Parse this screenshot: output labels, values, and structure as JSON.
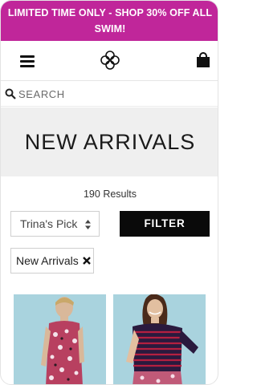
{
  "promo": {
    "text": "LIMITED TIME ONLY - SHOP 30% OFF ALL SWIM!",
    "background": "#c0269a"
  },
  "header": {
    "menu_icon": "hamburger-menu-icon",
    "logo": "flower-logo",
    "cart_icon": "shopping-bag-icon"
  },
  "search": {
    "placeholder": "SEARCH",
    "icon": "search-icon"
  },
  "page": {
    "title": "NEW ARRIVALS"
  },
  "results": {
    "count_text": "190 Results"
  },
  "sort": {
    "selected": "Trina's Pick"
  },
  "filter": {
    "label": "FILTER"
  },
  "active_filters": [
    {
      "label": "New Arrivals"
    }
  ],
  "products": [
    {
      "image": "woman in floral pink and black print sleeveless dress"
    },
    {
      "image": "woman in navy and red striped off-shoulder top"
    }
  ],
  "colors": {
    "accent": "#c0269a",
    "button": "#0a0a0a",
    "hero_bg": "#efefef",
    "product_bg": "#a9d3de"
  }
}
